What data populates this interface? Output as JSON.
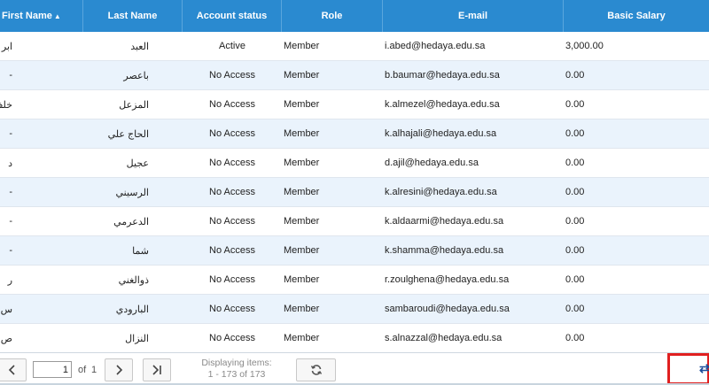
{
  "columns": {
    "first_name": "First Name",
    "last_name": "Last Name",
    "account_status": "Account status",
    "role": "Role",
    "email": "E-mail",
    "basic_salary": "Basic Salary"
  },
  "rows": [
    {
      "first_name": "ابر",
      "last_name": "العبد",
      "status": "Active",
      "role": "Member",
      "email": "i.abed@hedaya.edu.sa",
      "salary": "3,000.00"
    },
    {
      "first_name": "-",
      "last_name": "باعصر",
      "status": "No Access",
      "role": "Member",
      "email": "b.baumar@hedaya.edu.sa",
      "salary": "0.00"
    },
    {
      "first_name": "خلف ر",
      "last_name": "المزعل",
      "status": "No Access",
      "role": "Member",
      "email": "k.almezel@hedaya.edu.sa",
      "salary": "0.00"
    },
    {
      "first_name": "-",
      "last_name": "الحاج علي",
      "status": "No Access",
      "role": "Member",
      "email": "k.alhajali@hedaya.edu.sa",
      "salary": "0.00"
    },
    {
      "first_name": "د",
      "last_name": "عجيل",
      "status": "No Access",
      "role": "Member",
      "email": "d.ajil@hedaya.edu.sa",
      "salary": "0.00"
    },
    {
      "first_name": "-",
      "last_name": "الرسيني",
      "status": "No Access",
      "role": "Member",
      "email": "k.alresini@hedaya.edu.sa",
      "salary": "0.00"
    },
    {
      "first_name": "-",
      "last_name": "الدعرمي",
      "status": "No Access",
      "role": "Member",
      "email": "k.aldaarmi@hedaya.edu.sa",
      "salary": "0.00"
    },
    {
      "first_name": "-",
      "last_name": "شما",
      "status": "No Access",
      "role": "Member",
      "email": "k.shamma@hedaya.edu.sa",
      "salary": "0.00"
    },
    {
      "first_name": "ر",
      "last_name": "ذوالغني",
      "status": "No Access",
      "role": "Member",
      "email": "r.zoulghena@hedaya.edu.sa",
      "salary": "0.00"
    },
    {
      "first_name": "س",
      "last_name": "البارودي",
      "status": "No Access",
      "role": "Member",
      "email": "sambaroudi@hedaya.edu.sa",
      "salary": "0.00"
    },
    {
      "first_name": "ص",
      "last_name": "النزال",
      "status": "No Access",
      "role": "Member",
      "email": "s.alnazzal@hedaya.edu.sa",
      "salary": "0.00"
    }
  ],
  "pager": {
    "current_page": "1",
    "of_label": "of",
    "total_pages": "1",
    "displaying_label": "Displaying items:",
    "displaying_range": "1 - 173 of 173"
  },
  "colors": {
    "header_bg": "#2a8ad0",
    "alt_row_bg": "#eaf3fc",
    "highlight_box": "#e02020"
  }
}
